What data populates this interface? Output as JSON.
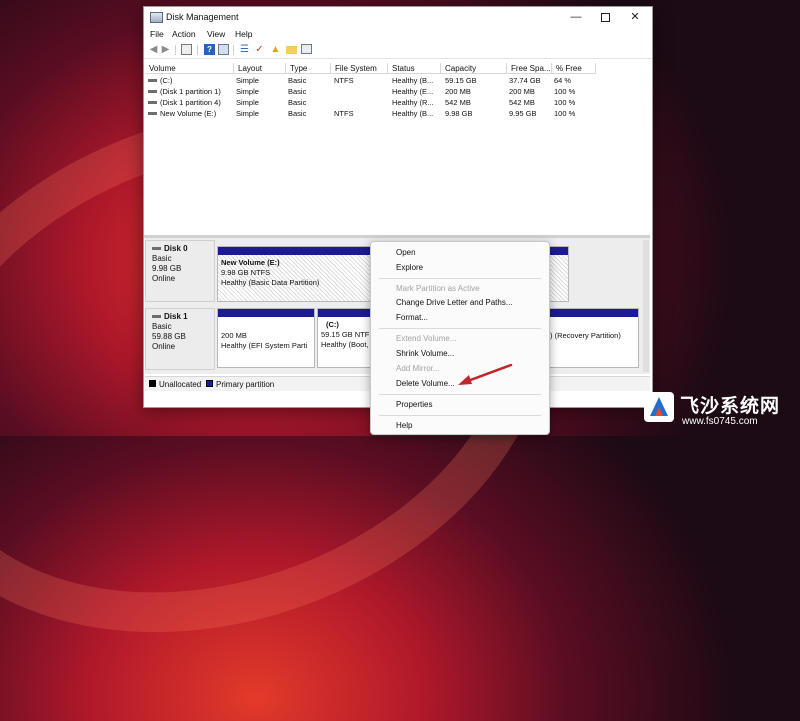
{
  "window": {
    "title": "Disk Management"
  },
  "menu": [
    "File",
    "Action",
    "View",
    "Help"
  ],
  "toolbar_icons": [
    "back-arrow-icon",
    "forward-arrow-icon",
    "volume-list-icon",
    "help-icon",
    "disk-properties-icon",
    "settings-icon",
    "check-icon",
    "up-arrow-icon",
    "folder-icon",
    "properties-icon"
  ],
  "volume_columns": [
    "Volume",
    "Layout",
    "Type",
    "File System",
    "Status",
    "Capacity",
    "Free Spa...",
    "% Free"
  ],
  "volumes": [
    [
      "(C:)",
      "Simple",
      "Basic",
      "NTFS",
      "Healthy (B...",
      "59.15 GB",
      "37.74 GB",
      "64 %"
    ],
    [
      "(Disk 1 partition 1)",
      "Simple",
      "Basic",
      "",
      "Healthy (E...",
      "200 MB",
      "200 MB",
      "100 %"
    ],
    [
      "(Disk 1 partition 4)",
      "Simple",
      "Basic",
      "",
      "Healthy (R...",
      "542 MB",
      "542 MB",
      "100 %"
    ],
    [
      "New Volume (E:)",
      "Simple",
      "Basic",
      "NTFS",
      "Healthy (B...",
      "9.98 GB",
      "9.95 GB",
      "100 %"
    ]
  ],
  "disks": [
    {
      "name": "Disk 0",
      "type": "Basic",
      "size": "9.98 GB",
      "status": "Online",
      "partitions": [
        {
          "name": "New Volume  (E:)",
          "size_fs": "9.98 GB NTFS",
          "status": "Healthy (Basic Data Partition)"
        }
      ]
    },
    {
      "name": "Disk 1",
      "type": "Basic",
      "size": "59.88 GB",
      "status": "Online",
      "partitions": [
        {
          "name": "",
          "size_fs": "200 MB",
          "status": "Healthy (EFI System Parti"
        },
        {
          "name": "(C:)",
          "size_fs": "59.15 GB NTFS",
          "status": "Healthy (Boot,"
        },
        {
          "name": "",
          "size_fs": "",
          "status": ") (Recovery Partition)"
        }
      ]
    }
  ],
  "legend": {
    "unallocated": "Unallocated",
    "primary": "Primary partition",
    "unallocated_color": "#000000",
    "primary_color": "#1c1b93"
  },
  "context_menu": {
    "items": [
      {
        "label": "Open",
        "enabled": true
      },
      {
        "label": "Explore",
        "enabled": true
      },
      {
        "label": "Mark Partition as Active",
        "enabled": false
      },
      {
        "label": "Change Drive Letter and Paths...",
        "enabled": true
      },
      {
        "label": "Format...",
        "enabled": true
      },
      {
        "label": "Extend Volume...",
        "enabled": false
      },
      {
        "label": "Shrink Volume...",
        "enabled": true
      },
      {
        "label": "Add Mirror...",
        "enabled": false
      },
      {
        "label": "Delete Volume...",
        "enabled": true
      },
      {
        "label": "Properties",
        "enabled": true
      },
      {
        "label": "Help",
        "enabled": true
      }
    ]
  },
  "watermark": {
    "title": "飞沙系统网",
    "url": "www.fs0745.com"
  },
  "colors": {
    "partition_bar": "#1c1b93",
    "arrow": "#c0262c"
  }
}
